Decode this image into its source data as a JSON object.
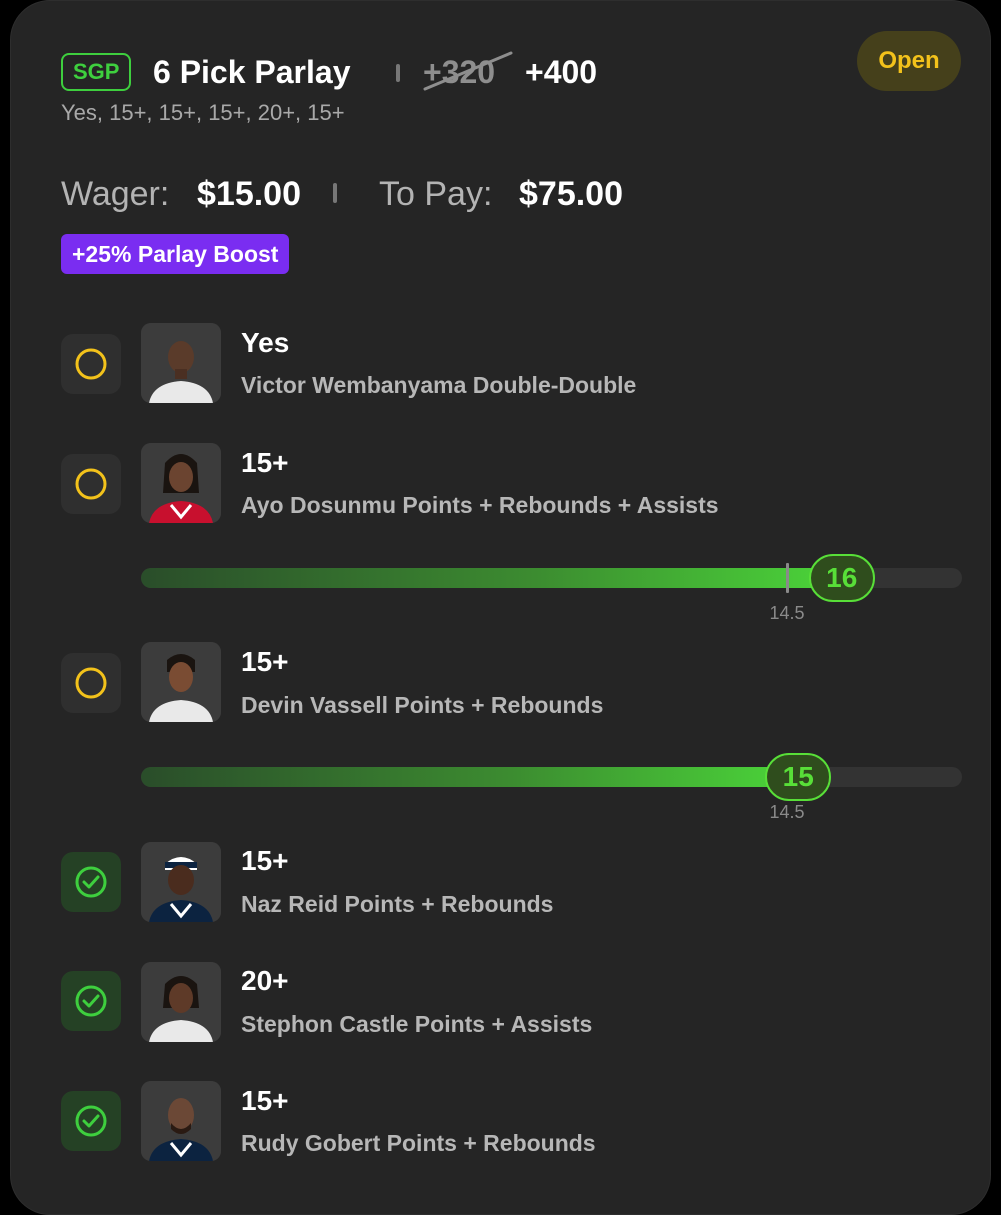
{
  "bet": {
    "badge": "SGP",
    "title": "6 Pick Parlay",
    "original_odds": "+320",
    "boosted_odds": "+400",
    "selections_summary": "Yes, 15+, 15+, 15+, 20+, 15+",
    "status": "Open",
    "wager_label": "Wager:",
    "wager_value": "$15.00",
    "topay_label": "To Pay:",
    "topay_value": "$75.00",
    "boost_label": "+25% Parlay Boost"
  },
  "legs": [
    {
      "line": "Yes",
      "desc": "Victor Wembanyama Double-Double",
      "status": "pending"
    },
    {
      "line": "15+",
      "desc": "Ayo Dosunmu Points + Rebounds + Assists",
      "status": "pending",
      "progress": {
        "current": "16",
        "threshold": "14.5",
        "fraction": 0.873
      }
    },
    {
      "line": "15+",
      "desc": "Devin Vassell Points + Rebounds",
      "status": "pending",
      "progress": {
        "current": "15",
        "threshold": "14.5",
        "fraction": 0.82
      }
    },
    {
      "line": "15+",
      "desc": "Naz Reid Points + Rebounds",
      "status": "won"
    },
    {
      "line": "20+",
      "desc": "Stephon Castle Points + Assists",
      "status": "won"
    },
    {
      "line": "15+",
      "desc": "Rudy Gobert Points + Rebounds",
      "status": "won"
    }
  ],
  "colors": {
    "win_green": "#3ecf3e",
    "pending_yellow": "#f3c21b",
    "boost_purple": "#7a2df1"
  },
  "icons": {
    "pending": "circle-outline-icon",
    "won": "check-circle-icon"
  }
}
